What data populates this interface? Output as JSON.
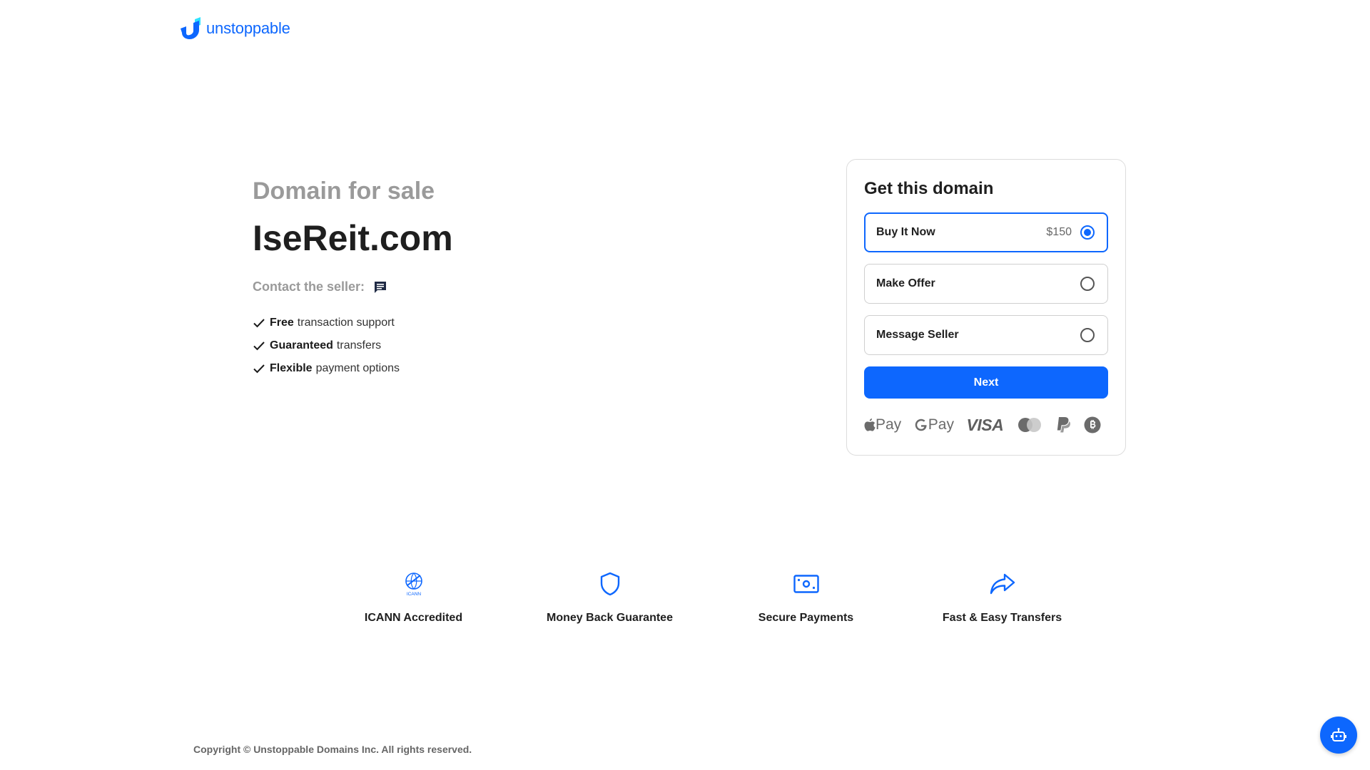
{
  "brand": {
    "name": "unstoppable",
    "color": "#0d67fe"
  },
  "hero": {
    "eyebrow": "Domain for sale",
    "domain": "IseReit.com",
    "contact_label": "Contact the seller:",
    "features": [
      {
        "bold": "Free",
        "rest": "transaction support"
      },
      {
        "bold": "Guaranteed",
        "rest": "transfers"
      },
      {
        "bold": "Flexible",
        "rest": "payment options"
      }
    ]
  },
  "purchase": {
    "title": "Get this domain",
    "options": [
      {
        "label": "Buy It Now",
        "price": "$150",
        "selected": true
      },
      {
        "label": "Make Offer",
        "price": "",
        "selected": false
      },
      {
        "label": "Message Seller",
        "price": "",
        "selected": false
      }
    ],
    "next_label": "Next",
    "payment_methods": {
      "apple": "Pay",
      "google": "Pay",
      "visa": "VISA"
    }
  },
  "trust": [
    {
      "label": "ICANN Accredited",
      "icon": "icann-icon",
      "icon_text": "ICANN"
    },
    {
      "label": "Money Back Guarantee",
      "icon": "shield-icon"
    },
    {
      "label": "Secure Payments",
      "icon": "cash-icon"
    },
    {
      "label": "Fast & Easy Transfers",
      "icon": "forward-arrow-icon"
    }
  ],
  "footer": {
    "copyright": "Copyright © Unstoppable Domains Inc. All rights reserved."
  }
}
